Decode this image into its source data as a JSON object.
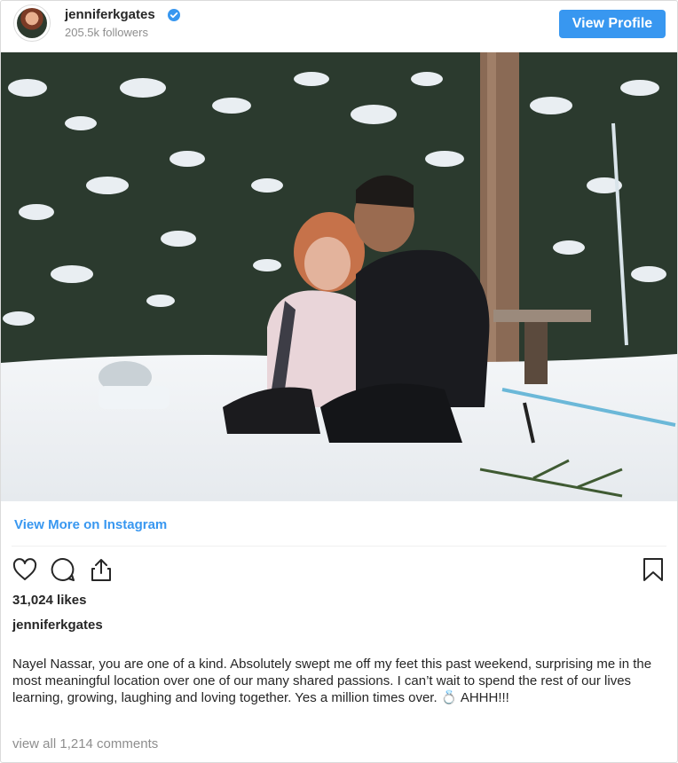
{
  "header": {
    "username": "jenniferkgates",
    "followers": "205.5k followers",
    "view_profile_label": "View Profile"
  },
  "post": {
    "view_more_label": "View More on Instagram",
    "likes": "31,024 likes",
    "caption_user": "jenniferkgates",
    "caption_text": "Nayel Nassar, you are one of a kind. Absolutely swept me off my feet this past weekend, surprising me in the most meaningful location over one of our many shared passions. I can’t wait to spend the rest of our lives learning, growing, laughing and loving together. Yes a million times over. 💍 AHHH!!!",
    "comments_link": "view all 1,214 comments"
  },
  "icons": [
    "avatar",
    "verified-badge-icon",
    "heart-icon",
    "comment-icon",
    "share-icon",
    "bookmark-icon"
  ],
  "colors": {
    "accent": "#3897f0",
    "muted_text": "#8e8e8e",
    "text": "#262626",
    "border": "#dbdbdb"
  }
}
